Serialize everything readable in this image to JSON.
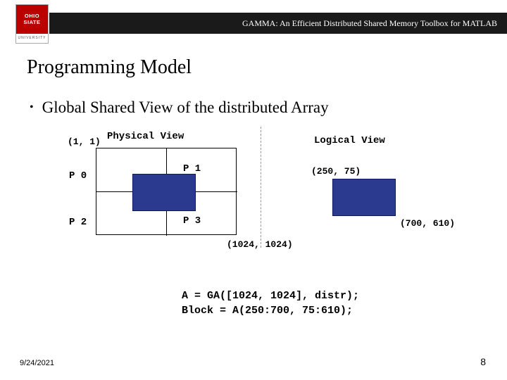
{
  "header": {
    "title": "GAMMA: An Efficient Distributed Shared Memory Toolbox for MATLAB"
  },
  "logo": {
    "line1": "OHIO",
    "line2": "SIATE",
    "footer": "UNIVERSITY"
  },
  "slide": {
    "title": "Programming Model",
    "bullet": "Global Shared View of the distributed Array"
  },
  "diagram": {
    "physical_label": "Physical View",
    "logical_label": "Logical View",
    "origin": "(1, 1)",
    "p0": "P 0",
    "p1": "P 1",
    "p2": "P 2",
    "p3": "P 3",
    "coord_topleft": "(250, 75)",
    "coord_bottomright": "(700, 610)",
    "coord_max": "(1024, 1024)"
  },
  "code": {
    "line1": "A = GA([1024, 1024], distr);",
    "line2": "Block = A(250:700, 75:610);"
  },
  "footer": {
    "date": "9/24/2021",
    "page": "8"
  }
}
